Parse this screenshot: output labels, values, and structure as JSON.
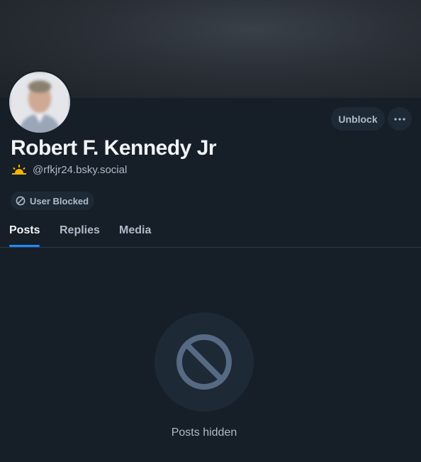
{
  "profile": {
    "display_name": "Robert F. Kennedy Jr",
    "handle": "@rfkjr24.bsky.social",
    "handle_emoji_icon": "sunrise-icon",
    "badge_label": "User Blocked",
    "badge_icon": "blocked-circle-icon"
  },
  "actions": {
    "unblock_label": "Unblock",
    "more_icon": "ellipsis-icon"
  },
  "tabs": [
    {
      "label": "Posts",
      "active": true
    },
    {
      "label": "Replies",
      "active": false
    },
    {
      "label": "Media",
      "active": false
    }
  ],
  "empty_state": {
    "icon": "prohibited-icon",
    "message": "Posts hidden"
  },
  "colors": {
    "background": "#161e27",
    "accent": "#208bfe",
    "muted_text": "#aebbc9",
    "surface": "#1e2936"
  }
}
